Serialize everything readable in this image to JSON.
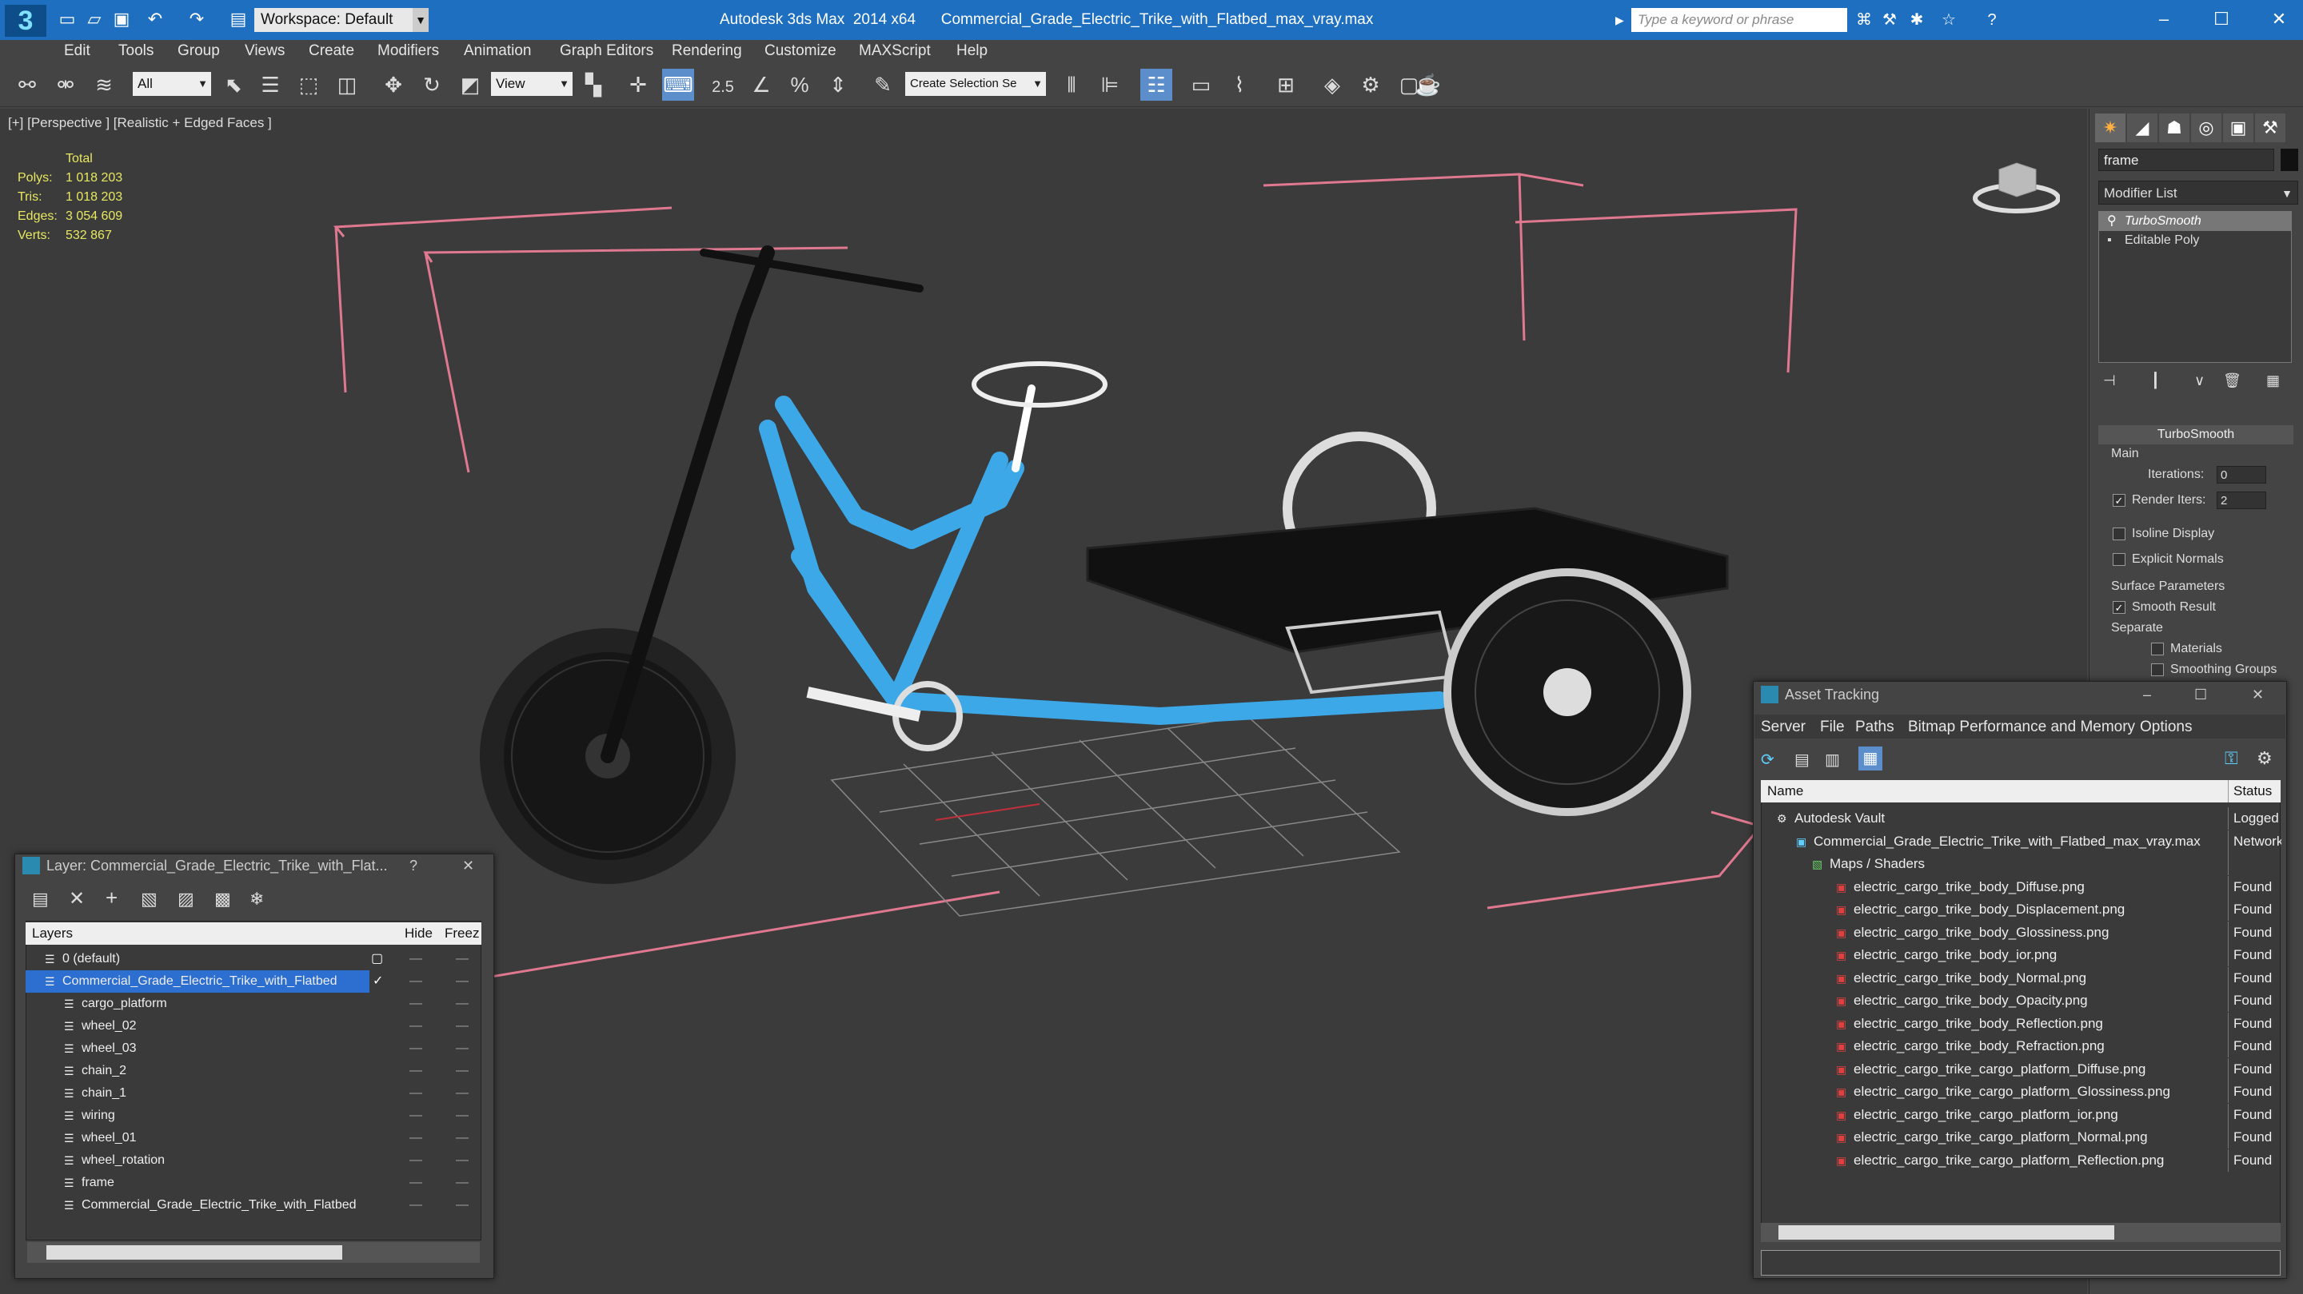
{
  "titlebar": {
    "workspace_label": "Workspace: Default",
    "app_title": "Autodesk 3ds Max  2014 x64",
    "file_title": "Commercial_Grade_Electric_Trike_with_Flatbed_max_vray.max",
    "search_placeholder": "Type a keyword or phrase"
  },
  "menu": [
    "Edit",
    "Tools",
    "Group",
    "Views",
    "Create",
    "Modifiers",
    "Animation",
    "Graph Editors",
    "Rendering",
    "Customize",
    "MAXScript",
    "Help"
  ],
  "toolbar": {
    "selection_filter": "All",
    "ref_coord": "View",
    "snap_label": "2.5",
    "selection_set_placeholder": "Create Selection Se"
  },
  "viewport": {
    "label": "[+] [Perspective ] [Realistic + Edged Faces ]",
    "stats": {
      "header": "Total",
      "rows": [
        {
          "label": "Polys:",
          "value": "1 018 203"
        },
        {
          "label": "Tris:",
          "value": "1 018 203"
        },
        {
          "label": "Edges:",
          "value": "3 054 609"
        },
        {
          "label": "Verts:",
          "value": "532 867"
        }
      ]
    }
  },
  "command_panel": {
    "object_name": "frame",
    "modifier_list": "Modifier List",
    "stack": [
      "TurboSmooth",
      "Editable Poly"
    ],
    "rollout_title": "TurboSmooth",
    "main_label": "Main",
    "iterations_label": "Iterations:",
    "iterations_value": "0",
    "render_iters_label": "Render Iters:",
    "render_iters_value": "2",
    "isoline_label": "Isoline Display",
    "explicit_label": "Explicit Normals",
    "surface_label": "Surface Parameters",
    "smooth_label": "Smooth Result",
    "separate_label": "Separate",
    "materials_label": "Materials",
    "smoothing_label": "Smoothing Groups"
  },
  "layer_window": {
    "title": "Layer: Commercial_Grade_Electric_Trike_with_Flat...",
    "help": "?",
    "columns": {
      "name": "Layers",
      "hide": "Hide",
      "freeze": "Freez"
    },
    "rows": [
      {
        "name": "0 (default)",
        "level": 1
      },
      {
        "name": "Commercial_Grade_Electric_Trike_with_Flatbed",
        "level": 1,
        "selected": true
      },
      {
        "name": "cargo_platform",
        "level": 2
      },
      {
        "name": "wheel_02",
        "level": 2
      },
      {
        "name": "wheel_03",
        "level": 2
      },
      {
        "name": "chain_2",
        "level": 2
      },
      {
        "name": "chain_1",
        "level": 2
      },
      {
        "name": "wiring",
        "level": 2
      },
      {
        "name": "wheel_01",
        "level": 2
      },
      {
        "name": "wheel_rotation",
        "level": 2
      },
      {
        "name": "frame",
        "level": 2
      },
      {
        "name": "Commercial_Grade_Electric_Trike_with_Flatbed",
        "level": 2
      }
    ]
  },
  "asset_window": {
    "title": "Asset Tracking",
    "menu": [
      "Server",
      "File",
      "Paths",
      "Bitmap Performance and Memory",
      "Options"
    ],
    "columns": {
      "name": "Name",
      "status": "Status"
    },
    "rows": [
      {
        "name": "Autodesk Vault",
        "status": "Logged",
        "level": 1
      },
      {
        "name": "Commercial_Grade_Electric_Trike_with_Flatbed_max_vray.max",
        "status": "Network",
        "level": 2
      },
      {
        "name": "Maps / Shaders",
        "status": "",
        "level": 3
      },
      {
        "name": "electric_cargo_trike_body_Diffuse.png",
        "status": "Found",
        "level": 4
      },
      {
        "name": "electric_cargo_trike_body_Displacement.png",
        "status": "Found",
        "level": 4
      },
      {
        "name": "electric_cargo_trike_body_Glossiness.png",
        "status": "Found",
        "level": 4
      },
      {
        "name": "electric_cargo_trike_body_ior.png",
        "status": "Found",
        "level": 4
      },
      {
        "name": "electric_cargo_trike_body_Normal.png",
        "status": "Found",
        "level": 4
      },
      {
        "name": "electric_cargo_trike_body_Opacity.png",
        "status": "Found",
        "level": 4
      },
      {
        "name": "electric_cargo_trike_body_Reflection.png",
        "status": "Found",
        "level": 4
      },
      {
        "name": "electric_cargo_trike_body_Refraction.png",
        "status": "Found",
        "level": 4
      },
      {
        "name": "electric_cargo_trike_cargo_platform_Diffuse.png",
        "status": "Found",
        "level": 4
      },
      {
        "name": "electric_cargo_trike_cargo_platform_Glossiness.png",
        "status": "Found",
        "level": 4
      },
      {
        "name": "electric_cargo_trike_cargo_platform_ior.png",
        "status": "Found",
        "level": 4
      },
      {
        "name": "electric_cargo_trike_cargo_platform_Normal.png",
        "status": "Found",
        "level": 4
      },
      {
        "name": "electric_cargo_trike_cargo_platform_Reflection.png",
        "status": "Found",
        "level": 4
      }
    ]
  },
  "colors": {
    "titlebar": "#1e6fbf",
    "selection": "#2d6fd0",
    "frame_blue": "#3da8e8",
    "bbox_pink": "#e07890",
    "stats_yellow": "#e8e860"
  }
}
